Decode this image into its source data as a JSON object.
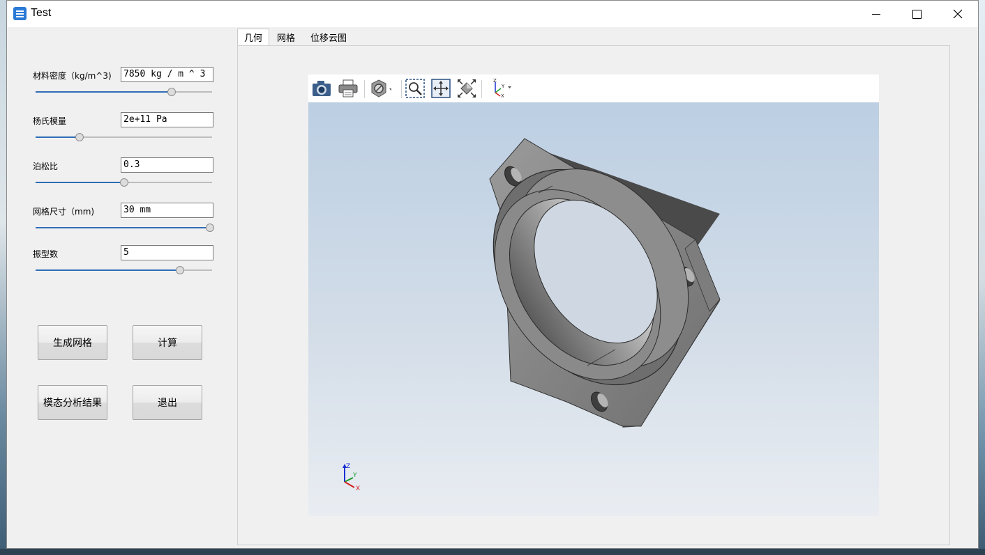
{
  "window": {
    "title": "Test",
    "controls": {
      "minimize": "minimize-icon",
      "maximize": "maximize-icon",
      "close": "close-icon"
    }
  },
  "properties": [
    {
      "label": "材料密度（kg/m^3)",
      "value": "7850 kg / m ^ 3",
      "slider_fraction": 0.77
    },
    {
      "label": "杨氏模量",
      "value": "2e+11 Pa",
      "slider_fraction": 0.25
    },
    {
      "label": "泊松比",
      "value": "0.3",
      "slider_fraction": 0.5
    },
    {
      "label": "网格尺寸（mm)",
      "value": "30 mm",
      "slider_fraction": 0.99
    },
    {
      "label": "振型数",
      "value": "5",
      "slider_fraction": 0.82
    }
  ],
  "buttons": {
    "generate_mesh": "生成网格",
    "compute": "计算",
    "modal_results": "模态分析结果",
    "exit": "退出"
  },
  "tabs": [
    {
      "label": "几何",
      "active": true
    },
    {
      "label": "网格",
      "active": false
    },
    {
      "label": "位移云图",
      "active": false
    }
  ],
  "viewer_toolbar": [
    "camera-icon",
    "print-icon",
    "display-mode-icon",
    "zoom-window-icon",
    "pan-icon",
    "fit-all-icon",
    "view-axes-icon"
  ],
  "colors": {
    "accent": "#2f6cb5",
    "viewport_top": "#bccfe3",
    "viewport_bottom": "#e9edf2",
    "model_gray": "#8c8c8c"
  }
}
